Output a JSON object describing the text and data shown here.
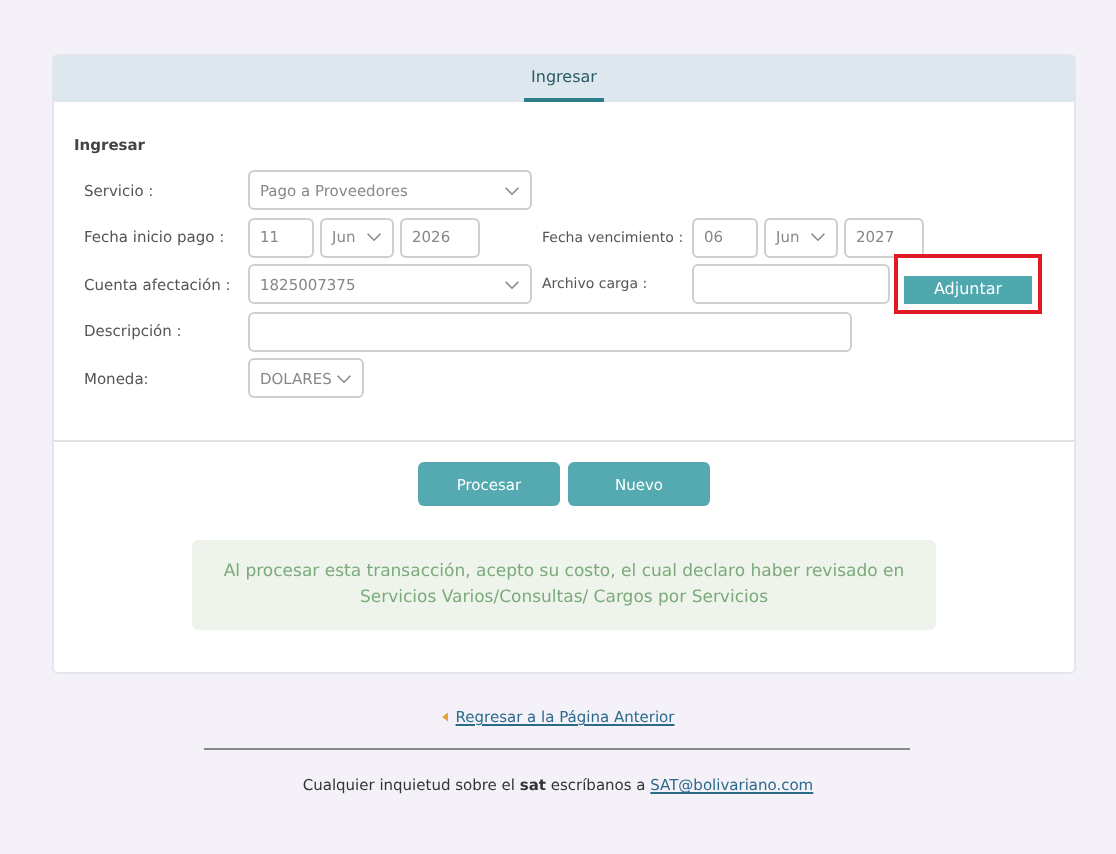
{
  "tabs": [
    {
      "label": "Ingresar",
      "selected": true
    }
  ],
  "section_title": "Ingresar",
  "form": {
    "servicio": {
      "label": "Servicio :",
      "value": "Pago a Proveedores"
    },
    "fecha_inicio": {
      "label": "Fecha inicio pago :",
      "day": "11",
      "month": "Jun",
      "year": "2026"
    },
    "fecha_vencimiento": {
      "label": "Fecha vencimiento :",
      "day": "06",
      "month": "Jun",
      "year": "2027"
    },
    "cuenta": {
      "label": "Cuenta afectación :",
      "value": "1825007375"
    },
    "archivo": {
      "label": "Archivo carga :",
      "button": "Adjuntar",
      "highlighted": true
    },
    "descripcion": {
      "label": "Descripción :"
    },
    "moneda": {
      "label": "Moneda:",
      "value": "DOLARES"
    }
  },
  "buttons": [
    "Procesar",
    "Nuevo"
  ],
  "notice": "Al procesar esta transacción, acepto su costo, el cual declaro haber revisado en Servicios Varios/Consultas/ Cargos por Servicios",
  "back_link": "Regresar a la Página Anterior",
  "footer": {
    "text": "Cualquier inquietud sobre el **sat** escríbanos a ",
    "email": "SAT@bolivariano.com"
  }
}
